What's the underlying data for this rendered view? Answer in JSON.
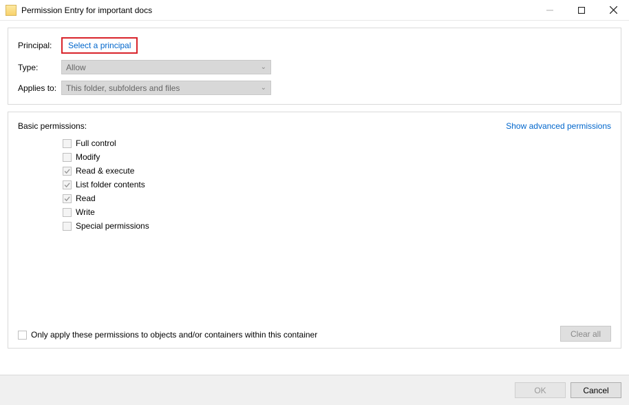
{
  "titlebar": {
    "title": "Permission Entry for important docs"
  },
  "form": {
    "principal_label": "Principal:",
    "select_principal": "Select a principal",
    "type_label": "Type:",
    "type_value": "Allow",
    "applies_label": "Applies to:",
    "applies_value": "This folder, subfolders and files"
  },
  "perms": {
    "title": "Basic permissions:",
    "advanced_link": "Show advanced permissions",
    "items": [
      {
        "label": "Full control",
        "checked": false
      },
      {
        "label": "Modify",
        "checked": false
      },
      {
        "label": "Read & execute",
        "checked": true
      },
      {
        "label": "List folder contents",
        "checked": true
      },
      {
        "label": "Read",
        "checked": true
      },
      {
        "label": "Write",
        "checked": false
      },
      {
        "label": "Special permissions",
        "checked": false
      }
    ],
    "only_apply": "Only apply these permissions to objects and/or containers within this container",
    "clear_all": "Clear all"
  },
  "footer": {
    "ok": "OK",
    "cancel": "Cancel"
  }
}
